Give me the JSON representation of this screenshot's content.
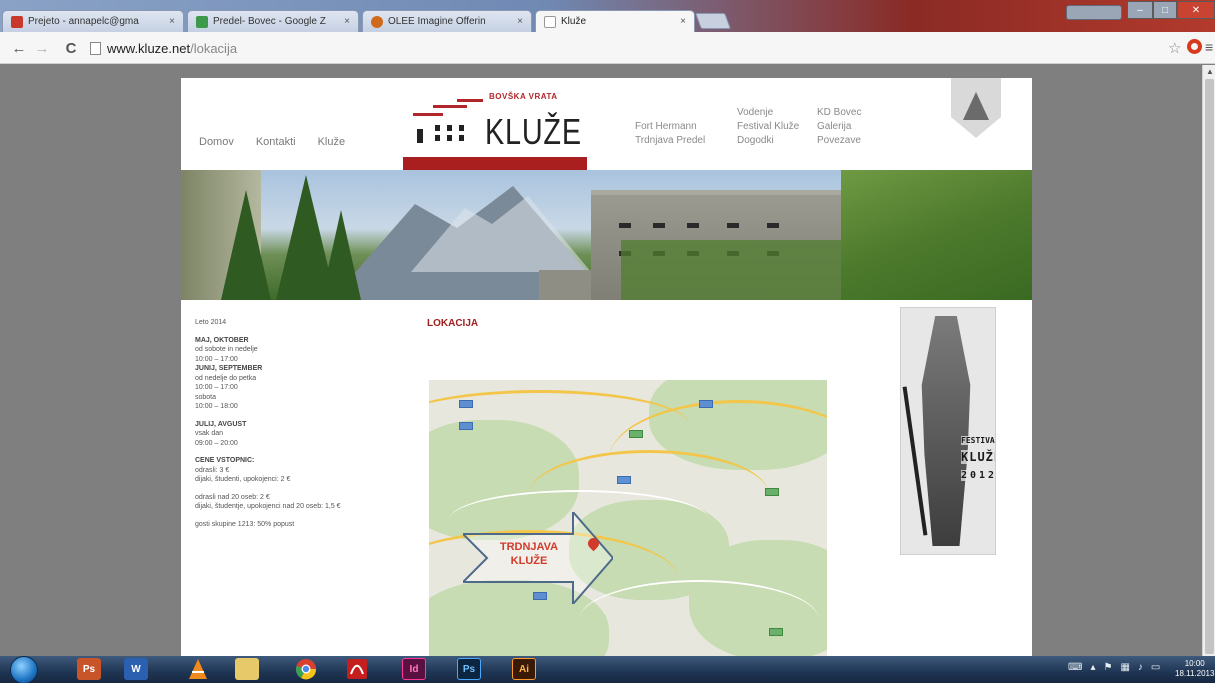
{
  "browser": {
    "tabs": [
      {
        "label": "Prejeto - annapelc@gma"
      },
      {
        "label": "Predel- Bovec - Google Z"
      },
      {
        "label": "OLEE Imagine Offerin"
      },
      {
        "label": "Kluže"
      }
    ],
    "url_host": "www.kluze.net",
    "url_path": "/lokacija"
  },
  "site": {
    "top_nav": [
      "Domov",
      "Kontakti",
      "Kluže"
    ],
    "logo_top": "BOVŠKA VRATA",
    "logo_name": "KLUŽE",
    "nav_col_a": [
      "Fort Hermann",
      "Trdnjava Predel"
    ],
    "nav_col_b": [
      "Vodenje",
      "Festival Kluže",
      "Dogodki"
    ],
    "nav_col_c": [
      "KD Bovec",
      "Galerija",
      "Povezave"
    ]
  },
  "hours": {
    "season": "Leto 2014",
    "blocks": [
      {
        "head": "MAJ, OKTOBER",
        "lines": [
          "od sobote in nedelje",
          "10:00 – 17:00"
        ]
      },
      {
        "head": "JUNIJ, SEPTEMBER",
        "lines": [
          "od nedelje do petka",
          "10:00 – 17:00",
          "sobota",
          "10:00 – 18:00"
        ]
      },
      {
        "head": "JULIJ, AVGUST",
        "lines": [
          "vsak dan",
          "09:00 – 20:00"
        ]
      }
    ],
    "prices_head": "CENE VSTOPNIC:",
    "prices": [
      "odrasli: 3 €",
      "dijaki, študenti, upokojenci: 2 €"
    ],
    "group_prices": [
      "odrasli nad 20 oseb: 2 €",
      "dijaki, študentje, upokojenci nad 20 oseb: 1,5 €"
    ],
    "note": "gosti skupine 1213: 50% popust"
  },
  "location_title": "LOKACIJA",
  "map_label": [
    "TRDNJAVA",
    "KLUŽE"
  ],
  "poster": {
    "line1": "FESTIVAL",
    "line2": "KLUŽE",
    "line3": "2012"
  },
  "taskbar": {
    "apps": [
      "Ps",
      "W",
      "",
      "",
      "",
      "",
      "Id",
      "Ps",
      "Ai"
    ],
    "clock_time": "10:00",
    "clock_date": "18.11.2013"
  },
  "colors": {
    "accent_red": "#a91f1f",
    "map_label_red": "#d23a2c"
  }
}
